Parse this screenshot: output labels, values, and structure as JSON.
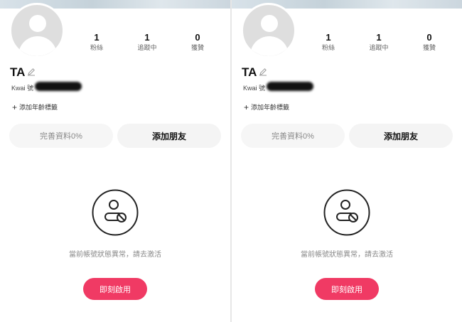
{
  "panels": [
    {
      "profile": {
        "name": "TA",
        "kwai_label": "Kwai 號"
      },
      "stats": [
        {
          "value": "1",
          "label": "粉絲"
        },
        {
          "value": "1",
          "label": "追蹤中"
        },
        {
          "value": "0",
          "label": "獲贊"
        }
      ],
      "add_tag_label": "添加年齡標籤",
      "complete_button": "完善資料0%",
      "add_friend_button": "添加朋友",
      "status_message": "當前帳號狀態異常，請去激活",
      "activate_button": "即刻啟用"
    },
    {
      "profile": {
        "name": "TA",
        "kwai_label": "Kwai 號"
      },
      "stats": [
        {
          "value": "1",
          "label": "粉絲"
        },
        {
          "value": "1",
          "label": "追蹤中"
        },
        {
          "value": "0",
          "label": "獲贊"
        }
      ],
      "add_tag_label": "添加年齡標籤",
      "complete_button": "完善資料0%",
      "add_friend_button": "添加朋友",
      "status_message": "當前帳號狀態異常，請去激活",
      "activate_button": "即刻啟用"
    }
  ],
  "colors": {
    "accent": "#f03a64",
    "secondary_button_bg": "#f4f4f4",
    "muted_text": "#888888"
  },
  "icons": {
    "avatar": "default-avatar-icon",
    "edit": "pencil-icon",
    "add": "plus-icon",
    "status": "user-blocked-icon"
  }
}
